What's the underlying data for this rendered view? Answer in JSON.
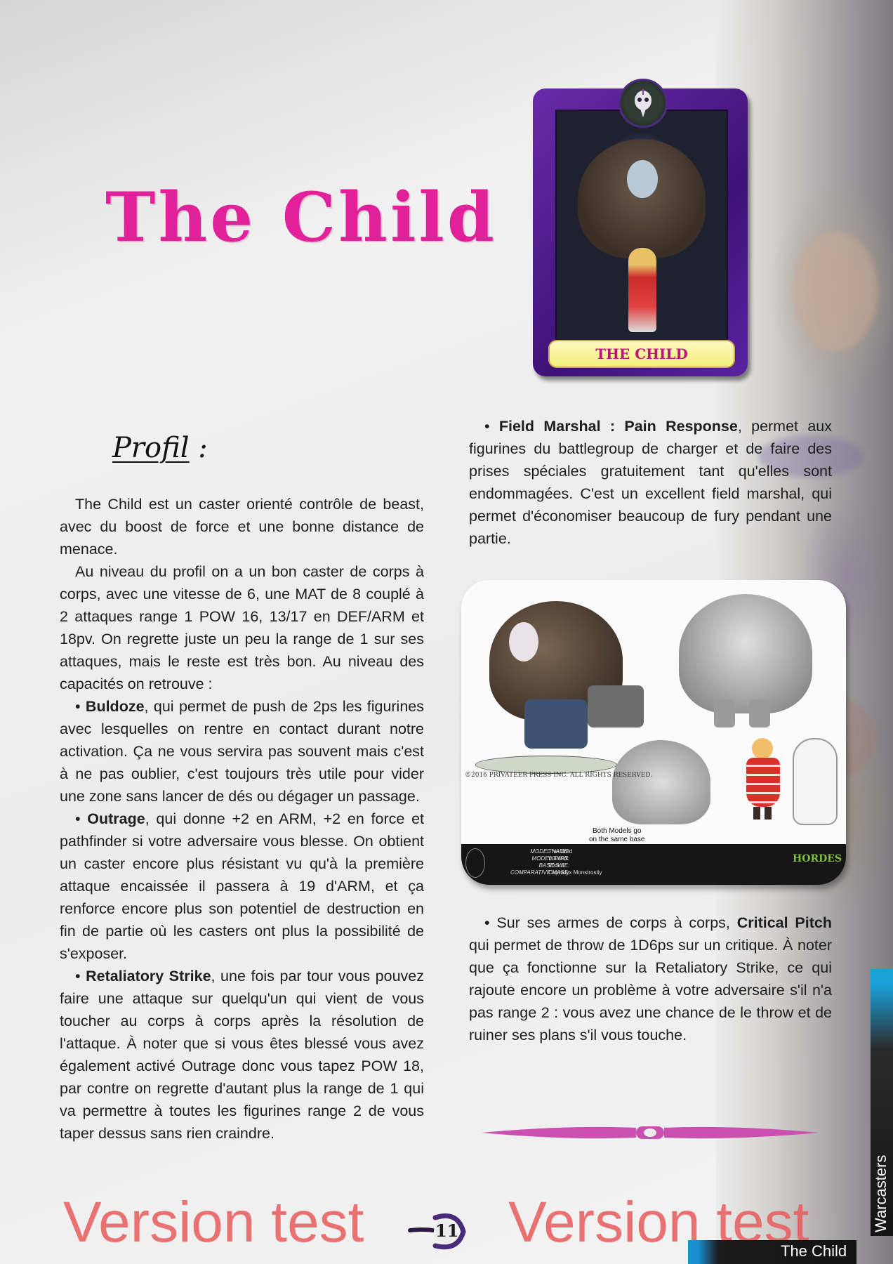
{
  "title": "The Child",
  "card": {
    "name_plate": "THE CHILD"
  },
  "profil_heading": "Profil",
  "profil_colon": " :",
  "left_column": {
    "p1": "The Child est un caster orienté contrôle de beast, avec du boost de force et une bonne distance de menace.",
    "p2": "Au niveau du profil on a un bon caster de corps à corps, avec une vitesse de 6, une MAT de 8 couplé à 2 attaques range 1 POW 16, 13/17 en DEF/ARM et 18pv. On regrette juste un peu la range de 1 sur ses attaques, mais le reste est très bon. Au niveau des capacités on retrouve :",
    "bullet": "•",
    "buldoze_name": "Buldoze",
    "buldoze_text": ", qui permet de push de 2ps les figurines avec lesquelles on rentre en contact durant notre activation. Ça ne vous servira pas souvent mais c'est à ne pas oublier, c'est toujours très utile pour vider une zone sans lancer de dés ou dégager un passage.",
    "outrage_name": "Outrage",
    "outrage_text": ", qui donne +2 en ARM, +2 en force et pathfinder si votre adversaire vous blesse. On obtient un caster encore plus résistant vu qu'à la première attaque encaissée il passera à 19 d'ARM, et ça renforce encore plus son potentiel de destruction en fin de partie où les casters ont plus la possibilité de s'exposer.",
    "retaliatory_name": "Retaliatory Strike",
    "retaliatory_text": ", une fois par tour vous pouvez faire une attaque sur quelqu'un qui vient de vous toucher au corps à corps après la résolution de l'attaque. À noter que si vous êtes blessé vous avez également activé Outrage donc vous tapez POW 18, par contre on regrette d'autant plus la range de 1 qui va permettre à toutes les figurines range 2 de vous taper dessus sans rien craindre."
  },
  "right_column_top": {
    "bullet": "•",
    "field_marshal_name": "Field Marshal : Pain Response",
    "field_marshal_text": ", permet aux figurines du battlegroup de charger et de faire des prises spéciales gratuitement tant qu'elles sont endommagées. C'est un excellent field marshal, qui permet d'économiser beaucoup de fury pendant une partie."
  },
  "concept_art": {
    "copyright": "©2016 PRIVATEER PRESS INC. ALL RIGHTS RESERVED.",
    "base_note_line1": "Both Models go",
    "base_note_line2": "on the same base",
    "strip_labels": [
      "MODEL NAME:",
      "MODEL TYPE:",
      "BASE SIZE:",
      "COMPARATIVE MASS:"
    ],
    "strip_values": [
      "The Child",
      "Warlock",
      "50mm",
      "Cephalyx Monstrosity"
    ],
    "logo_text": "HORDES"
  },
  "right_column_bottom": {
    "bullet": "•",
    "intro": " Sur ses armes de corps à corps, ",
    "critical_pitch_name": "Critical Pitch",
    "critical_pitch_text": " qui permet de throw de 1D6ps sur un critique. À noter que ça fonctionne sur la Retaliatory Strike, ce qui rajoute encore un problème à votre adversaire s'il n'a pas range 2 : vous avez une chance de le throw et de ruiner ses plans s'il vous touche."
  },
  "footer": {
    "watermark_left": "Version test",
    "watermark_right": "Version test",
    "page_number": "11",
    "side_tab_label": "Warcasters",
    "footer_name": "The Child"
  },
  "colors": {
    "title_pink": "#e0219a",
    "watermark_red": "#e85a5a",
    "card_purple": "#4a1a8a",
    "divider_pink": "#c94fb0",
    "tab_blue": "#1aa0d8"
  }
}
